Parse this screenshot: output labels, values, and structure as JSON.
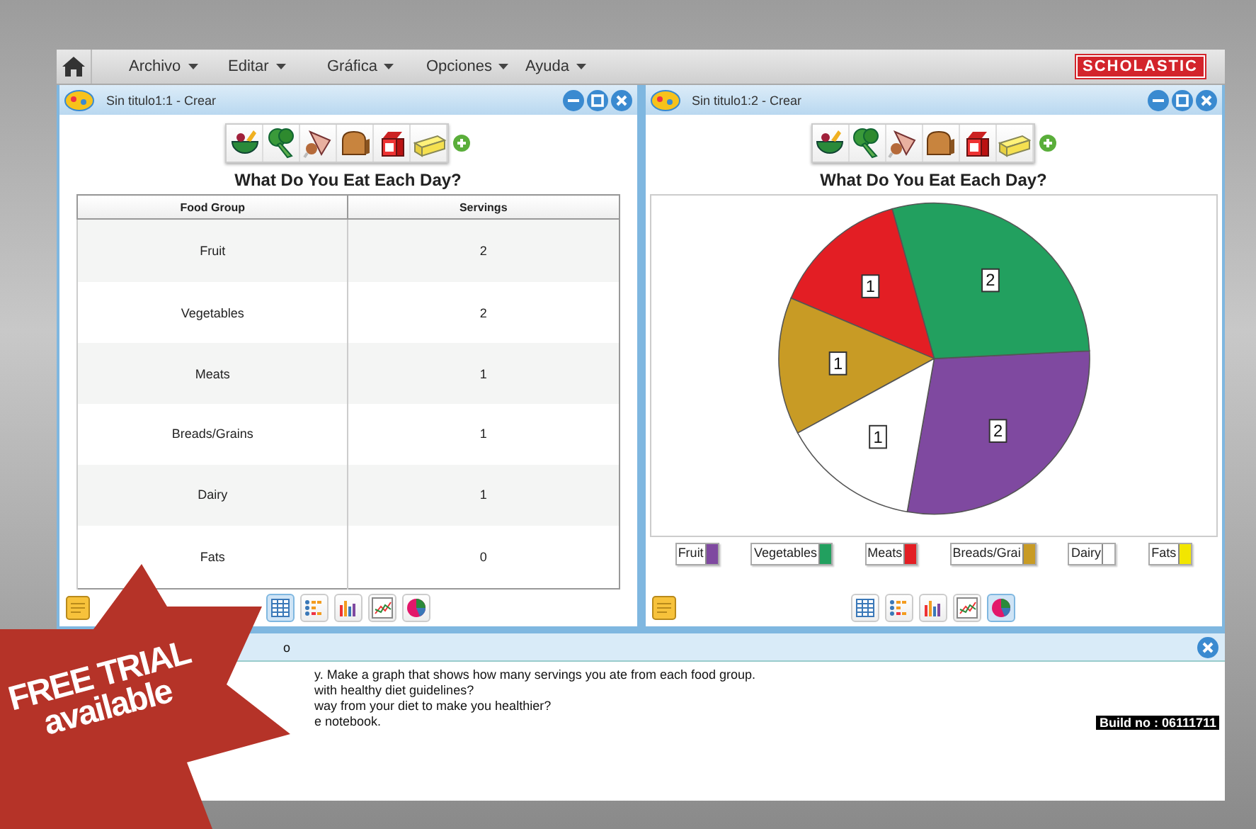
{
  "menu": {
    "items": [
      "Archivo",
      "Editar",
      "Gráfica",
      "Opciones",
      "Ayuda"
    ],
    "brand": "SCHOLASTIC"
  },
  "panels": [
    {
      "kind": "table",
      "title": "Sin titulo1:1 - Crear",
      "chart_title": "What Do You Eat Each Day?",
      "columns": [
        "Food Group",
        "Servings"
      ],
      "rows": [
        [
          "Fruit",
          "2"
        ],
        [
          "Vegetables",
          "2"
        ],
        [
          "Meats",
          "1"
        ],
        [
          "Breads/Grains",
          "1"
        ],
        [
          "Dairy",
          "1"
        ],
        [
          "Fats",
          "0"
        ]
      ],
      "views": [
        {
          "kind": "table",
          "selected": true
        },
        {
          "kind": "pictograph",
          "selected": false
        },
        {
          "kind": "bar",
          "selected": false
        },
        {
          "kind": "scatter",
          "selected": false
        },
        {
          "kind": "pie",
          "selected": false
        }
      ]
    },
    {
      "kind": "pie",
      "title": "Sin titulo1:2 - Crear",
      "chart_title": "What Do You Eat Each Day?",
      "chart_data": {
        "type": "pie",
        "categories": [
          "Fruit",
          "Vegetables",
          "Meats",
          "Breads/Grai",
          "Dairy",
          "Fats"
        ],
        "values": [
          2,
          2,
          1,
          1,
          1,
          0
        ],
        "data_labels": true
      },
      "legend": [
        {
          "color": "#7f49a0"
        },
        {
          "color": "#22a05f"
        },
        {
          "color": "#e31e24"
        },
        {
          "color": "#c89b25"
        },
        {
          "color": "#ffffff"
        },
        {
          "color": "#f2e600"
        }
      ],
      "views": [
        {
          "kind": "table",
          "selected": false
        },
        {
          "kind": "pictograph",
          "selected": false
        },
        {
          "kind": "bar",
          "selected": false
        },
        {
          "kind": "scatter",
          "selected": false
        },
        {
          "kind": "pie",
          "selected": true
        }
      ]
    }
  ],
  "notes": {
    "title": "o",
    "lines": [
      "y. Make a graph that shows how many servings you ate from each food group.",
      "with healthy diet guidelines?",
      "way from your diet to make you healthier?",
      "e notebook."
    ],
    "build": "Build no : 06111711"
  },
  "badge": {
    "lines": [
      "FREE TRIAL",
      "available"
    ]
  }
}
